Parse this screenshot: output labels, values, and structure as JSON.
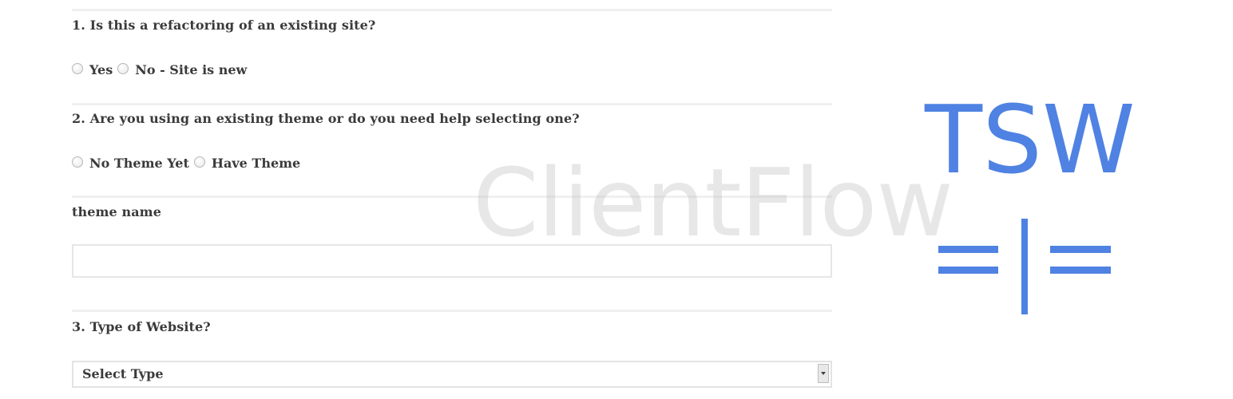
{
  "form": {
    "q1": {
      "label": "1. Is this a refactoring of an existing site?",
      "options": [
        "Yes",
        "No - Site is new"
      ]
    },
    "q2": {
      "label": "2. Are you using an existing theme or do you need help selecting one?",
      "options": [
        "No Theme Yet",
        "Have Theme"
      ]
    },
    "theme_name": {
      "label": "theme name",
      "value": ""
    },
    "q3": {
      "label": "3. Type of Website?",
      "selected": "Select Type"
    }
  },
  "watermark": "ClientFlow",
  "logo": {
    "text": "TSW",
    "color": "#4f82e2",
    "icon": "equals-bar-equals-icon"
  }
}
